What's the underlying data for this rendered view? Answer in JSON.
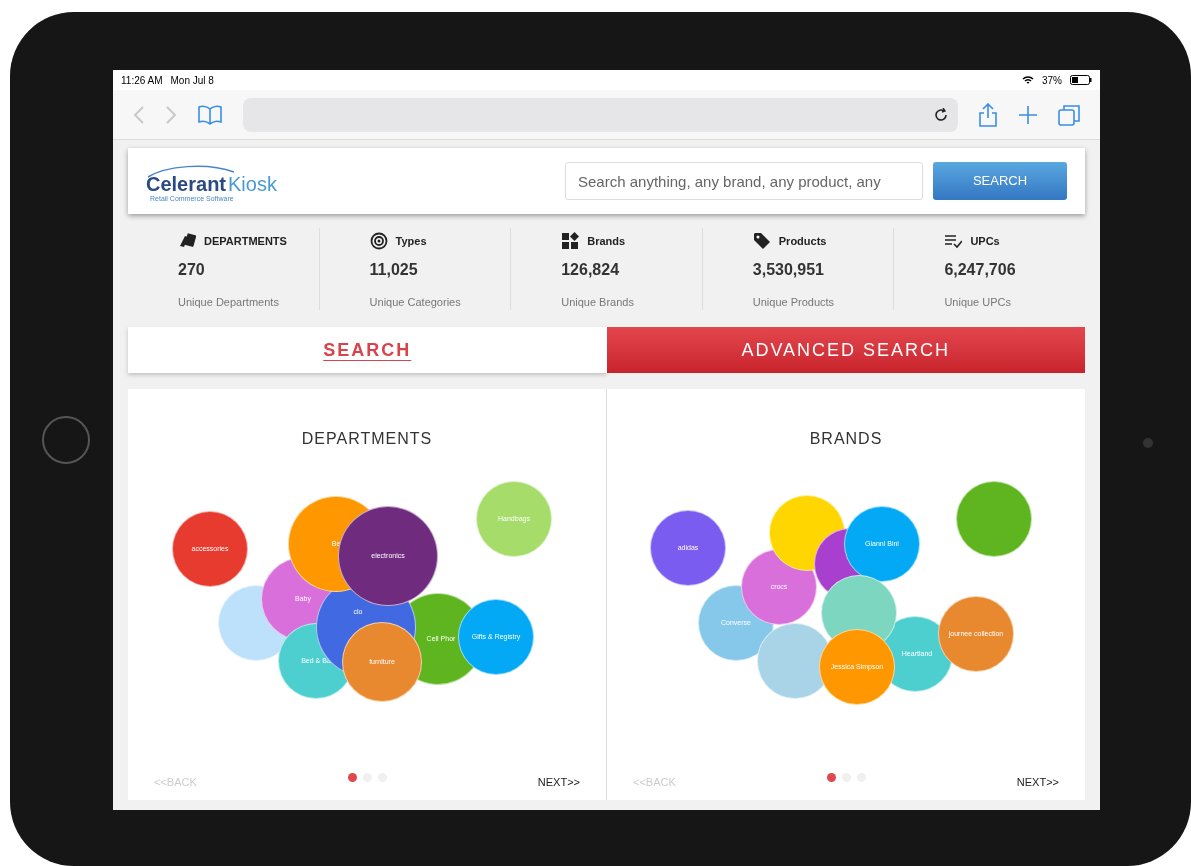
{
  "status_bar": {
    "time": "11:26 AM",
    "date": "Mon Jul 8",
    "battery": "37%"
  },
  "browser": {
    "back_disabled": true,
    "forward_disabled": true
  },
  "header": {
    "logo": {
      "name": "Celerant",
      "product": "Kiosk",
      "tagline": "Retail Commerce Software"
    },
    "search": {
      "placeholder": "Search anything, any brand, any product, any"
    },
    "search_button": "SEARCH"
  },
  "stats": [
    {
      "label": "DEPARTMENTS",
      "value": "270",
      "caption": "Unique Departments"
    },
    {
      "label": "Types",
      "value": "11,025",
      "caption": "Unique Categories"
    },
    {
      "label": "Brands",
      "value": "126,824",
      "caption": "Unique Brands"
    },
    {
      "label": "Products",
      "value": "3,530,951",
      "caption": "Unique Products"
    },
    {
      "label": "UPCs",
      "value": "6,247,706",
      "caption": "Unique UPCs"
    }
  ],
  "tabs": [
    {
      "label": "SEARCH",
      "selected": true
    },
    {
      "label": "ADVANCED SEARCH",
      "selected": false
    }
  ],
  "panels": [
    {
      "title": "DEPARTMENTS",
      "bubbles": [
        {
          "color": "#bde0fb"
        },
        {
          "label": "Baby",
          "color": "#d96fdb"
        },
        {
          "label": "Bed & Ba",
          "color": "#4ecfcf"
        },
        {
          "label": "Cell Phor",
          "color": "#5fb520"
        },
        {
          "label": "clo",
          "color": "#4169e1"
        },
        {
          "label": "Be",
          "color": "#ff9800"
        },
        {
          "label": "electronics",
          "color": "#6f2c7f"
        },
        {
          "label": "Gifts & Registry",
          "color": "#03a9f4"
        },
        {
          "label": "furniture",
          "color": "#e8892f"
        },
        {
          "label": "accessories",
          "color": "#e63b2e"
        },
        {
          "label": "Handbags",
          "color": "#a6dd6a"
        }
      ],
      "pages": [
        {
          "selected": true
        },
        {
          "selected": false
        },
        {
          "selected": false
        }
      ],
      "back": {
        "label": "<<BACK",
        "disabled": true
      },
      "next": {
        "label": "NEXT>>",
        "disabled": false
      }
    },
    {
      "title": "BRANDS",
      "bubbles": [
        {
          "label": "Converse",
          "color": "#86c8ea"
        },
        {
          "label": "crocs",
          "color": "#d96fdb"
        },
        {
          "color": "#ffd600"
        },
        {
          "color": "#a83fcf"
        },
        {
          "label": "Gianni Bini",
          "color": "#03a9f4"
        },
        {
          "label": "Heartland",
          "color": "#4ecfcf"
        },
        {
          "color": "#7dd6c0"
        },
        {
          "color": "#a9d3e6"
        },
        {
          "label": "Jessica Simpson",
          "color": "#ff9800"
        },
        {
          "label": "journee collection",
          "color": "#e8892f"
        },
        {
          "label": "adidas",
          "color": "#7b5cf0"
        },
        {
          "color": "#5fb520"
        }
      ],
      "pages": [
        {
          "selected": true
        },
        {
          "selected": false
        },
        {
          "selected": false
        }
      ],
      "back": {
        "label": "<<BACK",
        "disabled": true
      },
      "next": {
        "label": "NEXT>>",
        "disabled": false
      }
    }
  ]
}
